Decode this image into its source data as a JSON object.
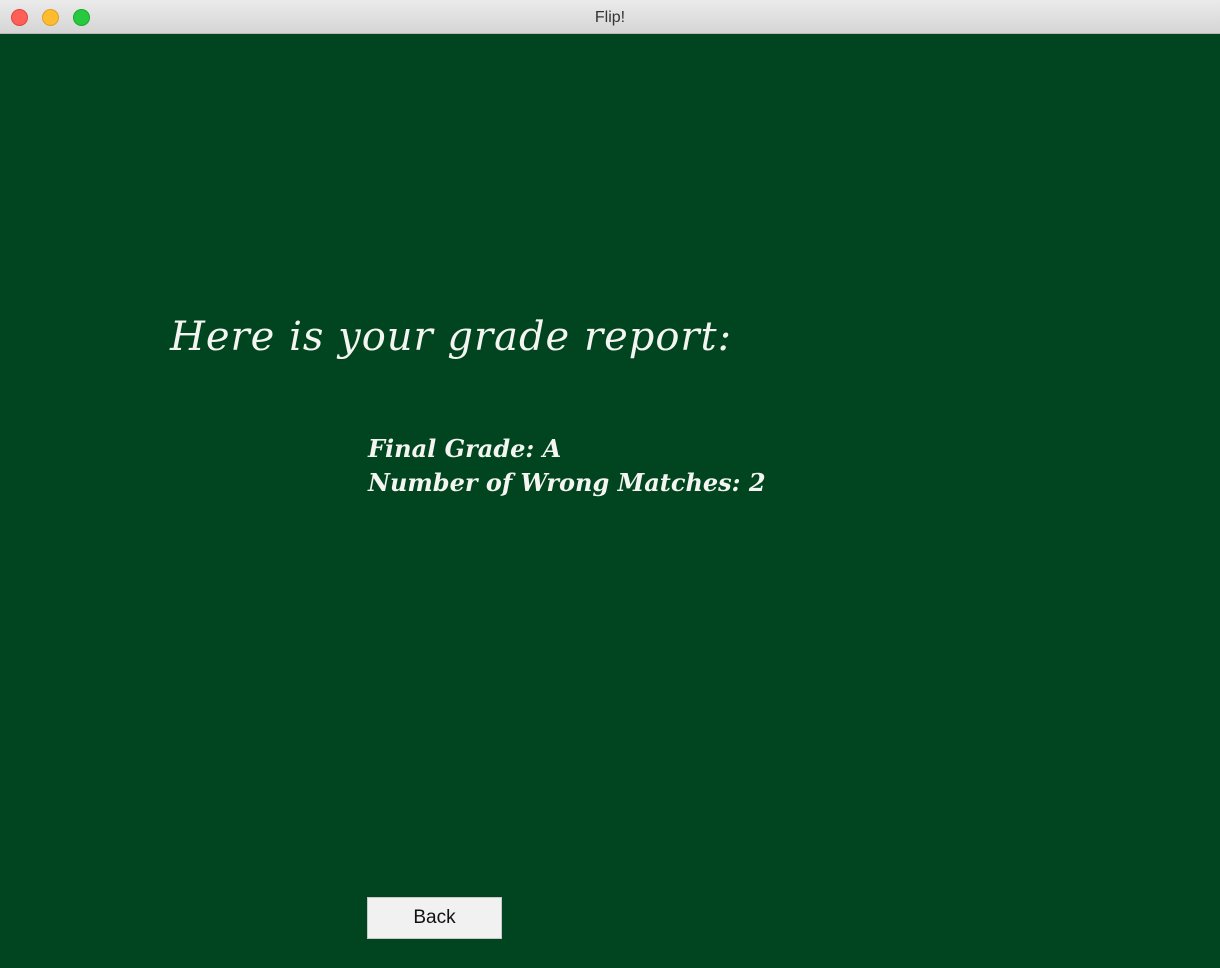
{
  "window": {
    "title": "Flip!"
  },
  "report": {
    "heading": "Here is your grade report:",
    "final_grade_line": "Final Grade: A",
    "wrong_matches_line": "Number of Wrong Matches: 2"
  },
  "actions": {
    "back_label": "Back"
  },
  "colors": {
    "background": "#00451f",
    "text": "#f4f4f0"
  }
}
